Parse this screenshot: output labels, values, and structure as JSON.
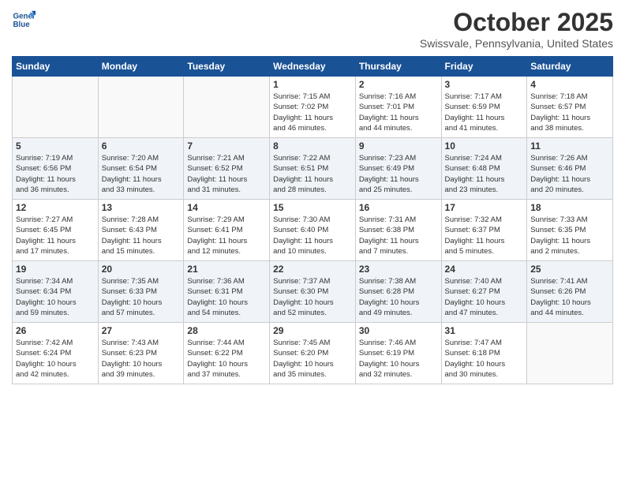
{
  "logo": {
    "line1": "General",
    "line2": "Blue"
  },
  "title": "October 2025",
  "location": "Swissvale, Pennsylvania, United States",
  "days_of_week": [
    "Sunday",
    "Monday",
    "Tuesday",
    "Wednesday",
    "Thursday",
    "Friday",
    "Saturday"
  ],
  "weeks": [
    [
      {
        "day": "",
        "info": ""
      },
      {
        "day": "",
        "info": ""
      },
      {
        "day": "",
        "info": ""
      },
      {
        "day": "1",
        "info": "Sunrise: 7:15 AM\nSunset: 7:02 PM\nDaylight: 11 hours\nand 46 minutes."
      },
      {
        "day": "2",
        "info": "Sunrise: 7:16 AM\nSunset: 7:01 PM\nDaylight: 11 hours\nand 44 minutes."
      },
      {
        "day": "3",
        "info": "Sunrise: 7:17 AM\nSunset: 6:59 PM\nDaylight: 11 hours\nand 41 minutes."
      },
      {
        "day": "4",
        "info": "Sunrise: 7:18 AM\nSunset: 6:57 PM\nDaylight: 11 hours\nand 38 minutes."
      }
    ],
    [
      {
        "day": "5",
        "info": "Sunrise: 7:19 AM\nSunset: 6:56 PM\nDaylight: 11 hours\nand 36 minutes."
      },
      {
        "day": "6",
        "info": "Sunrise: 7:20 AM\nSunset: 6:54 PM\nDaylight: 11 hours\nand 33 minutes."
      },
      {
        "day": "7",
        "info": "Sunrise: 7:21 AM\nSunset: 6:52 PM\nDaylight: 11 hours\nand 31 minutes."
      },
      {
        "day": "8",
        "info": "Sunrise: 7:22 AM\nSunset: 6:51 PM\nDaylight: 11 hours\nand 28 minutes."
      },
      {
        "day": "9",
        "info": "Sunrise: 7:23 AM\nSunset: 6:49 PM\nDaylight: 11 hours\nand 25 minutes."
      },
      {
        "day": "10",
        "info": "Sunrise: 7:24 AM\nSunset: 6:48 PM\nDaylight: 11 hours\nand 23 minutes."
      },
      {
        "day": "11",
        "info": "Sunrise: 7:26 AM\nSunset: 6:46 PM\nDaylight: 11 hours\nand 20 minutes."
      }
    ],
    [
      {
        "day": "12",
        "info": "Sunrise: 7:27 AM\nSunset: 6:45 PM\nDaylight: 11 hours\nand 17 minutes."
      },
      {
        "day": "13",
        "info": "Sunrise: 7:28 AM\nSunset: 6:43 PM\nDaylight: 11 hours\nand 15 minutes."
      },
      {
        "day": "14",
        "info": "Sunrise: 7:29 AM\nSunset: 6:41 PM\nDaylight: 11 hours\nand 12 minutes."
      },
      {
        "day": "15",
        "info": "Sunrise: 7:30 AM\nSunset: 6:40 PM\nDaylight: 11 hours\nand 10 minutes."
      },
      {
        "day": "16",
        "info": "Sunrise: 7:31 AM\nSunset: 6:38 PM\nDaylight: 11 hours\nand 7 minutes."
      },
      {
        "day": "17",
        "info": "Sunrise: 7:32 AM\nSunset: 6:37 PM\nDaylight: 11 hours\nand 5 minutes."
      },
      {
        "day": "18",
        "info": "Sunrise: 7:33 AM\nSunset: 6:35 PM\nDaylight: 11 hours\nand 2 minutes."
      }
    ],
    [
      {
        "day": "19",
        "info": "Sunrise: 7:34 AM\nSunset: 6:34 PM\nDaylight: 10 hours\nand 59 minutes."
      },
      {
        "day": "20",
        "info": "Sunrise: 7:35 AM\nSunset: 6:33 PM\nDaylight: 10 hours\nand 57 minutes."
      },
      {
        "day": "21",
        "info": "Sunrise: 7:36 AM\nSunset: 6:31 PM\nDaylight: 10 hours\nand 54 minutes."
      },
      {
        "day": "22",
        "info": "Sunrise: 7:37 AM\nSunset: 6:30 PM\nDaylight: 10 hours\nand 52 minutes."
      },
      {
        "day": "23",
        "info": "Sunrise: 7:38 AM\nSunset: 6:28 PM\nDaylight: 10 hours\nand 49 minutes."
      },
      {
        "day": "24",
        "info": "Sunrise: 7:40 AM\nSunset: 6:27 PM\nDaylight: 10 hours\nand 47 minutes."
      },
      {
        "day": "25",
        "info": "Sunrise: 7:41 AM\nSunset: 6:26 PM\nDaylight: 10 hours\nand 44 minutes."
      }
    ],
    [
      {
        "day": "26",
        "info": "Sunrise: 7:42 AM\nSunset: 6:24 PM\nDaylight: 10 hours\nand 42 minutes."
      },
      {
        "day": "27",
        "info": "Sunrise: 7:43 AM\nSunset: 6:23 PM\nDaylight: 10 hours\nand 39 minutes."
      },
      {
        "day": "28",
        "info": "Sunrise: 7:44 AM\nSunset: 6:22 PM\nDaylight: 10 hours\nand 37 minutes."
      },
      {
        "day": "29",
        "info": "Sunrise: 7:45 AM\nSunset: 6:20 PM\nDaylight: 10 hours\nand 35 minutes."
      },
      {
        "day": "30",
        "info": "Sunrise: 7:46 AM\nSunset: 6:19 PM\nDaylight: 10 hours\nand 32 minutes."
      },
      {
        "day": "31",
        "info": "Sunrise: 7:47 AM\nSunset: 6:18 PM\nDaylight: 10 hours\nand 30 minutes."
      },
      {
        "day": "",
        "info": ""
      }
    ]
  ]
}
